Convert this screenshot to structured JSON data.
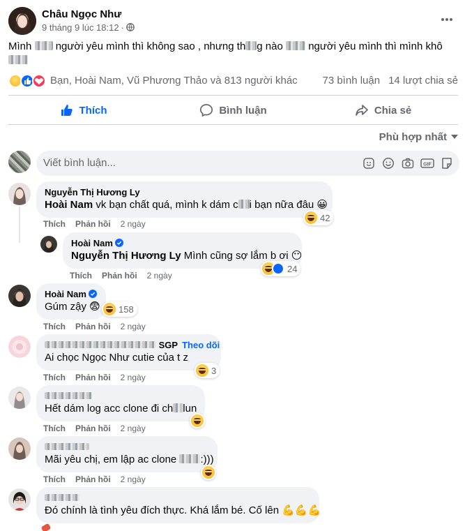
{
  "post": {
    "author": "Châu Ngọc Như",
    "timestamp": "9 tháng 9 lúc 18:12",
    "text_a": "Mình",
    "text_b": "người yêu mình thì không sao , nhưng th",
    "text_c": "g nào",
    "text_d": "người yêu mình thì mình khô",
    "reactions_names": "Bạn, Hoài Nam, Vũ Phương Thảo và 813 người khác",
    "comments_count": "73 bình luận",
    "shares_count": "14 lượt chia sẻ"
  },
  "actions": {
    "like": "Thích",
    "comment": "Bình luận",
    "share": "Chia sẻ"
  },
  "sort_label": "Phù hợp nhất",
  "composer": {
    "placeholder": "Viết bình luận..."
  },
  "comment_actions": {
    "like": "Thích",
    "reply": "Phản hồi"
  },
  "comments": [
    {
      "name": "Nguyễn Thị Hương Ly",
      "text_a": "Hoài Nam",
      "text_b": " vk bạn chất quá, mình k dám c",
      "text_c": "i bạn nữa đâu 😀",
      "reactions": "42",
      "time": "2 ngày"
    },
    {
      "name": "Hoài Nam",
      "text_a": "Nguyễn Thị Hương Ly",
      "text_b": " Mình cũng sợ lắm b ơi 😶",
      "reactions": "24",
      "time": "2 ngày"
    },
    {
      "name": "Hoài Nam",
      "text": "Gúm zậy 😨",
      "reactions": "158",
      "time": "2 ngày"
    },
    {
      "name": "SGP",
      "follow": "Theo dõi",
      "text": "Ai chọc Ngọc Như cutie của t z",
      "reactions": "3",
      "time": "2 ngày"
    },
    {
      "text_a": "Hết dám log acc clone đi ch",
      "text_b": "lun",
      "time": "2 ngày"
    },
    {
      "text_a": "Mãi yêu chị, em lập ac clone",
      "text_b": ":)))",
      "time": "2 ngày"
    },
    {
      "text": "Đó chính là tình yêu đích thực. Khá lắm bé. Cố lên 💪💪💪"
    }
  ],
  "colors": {
    "accent": "#0866ff",
    "bubble": "#f0f2f5",
    "secondary_text": "#65676b"
  }
}
